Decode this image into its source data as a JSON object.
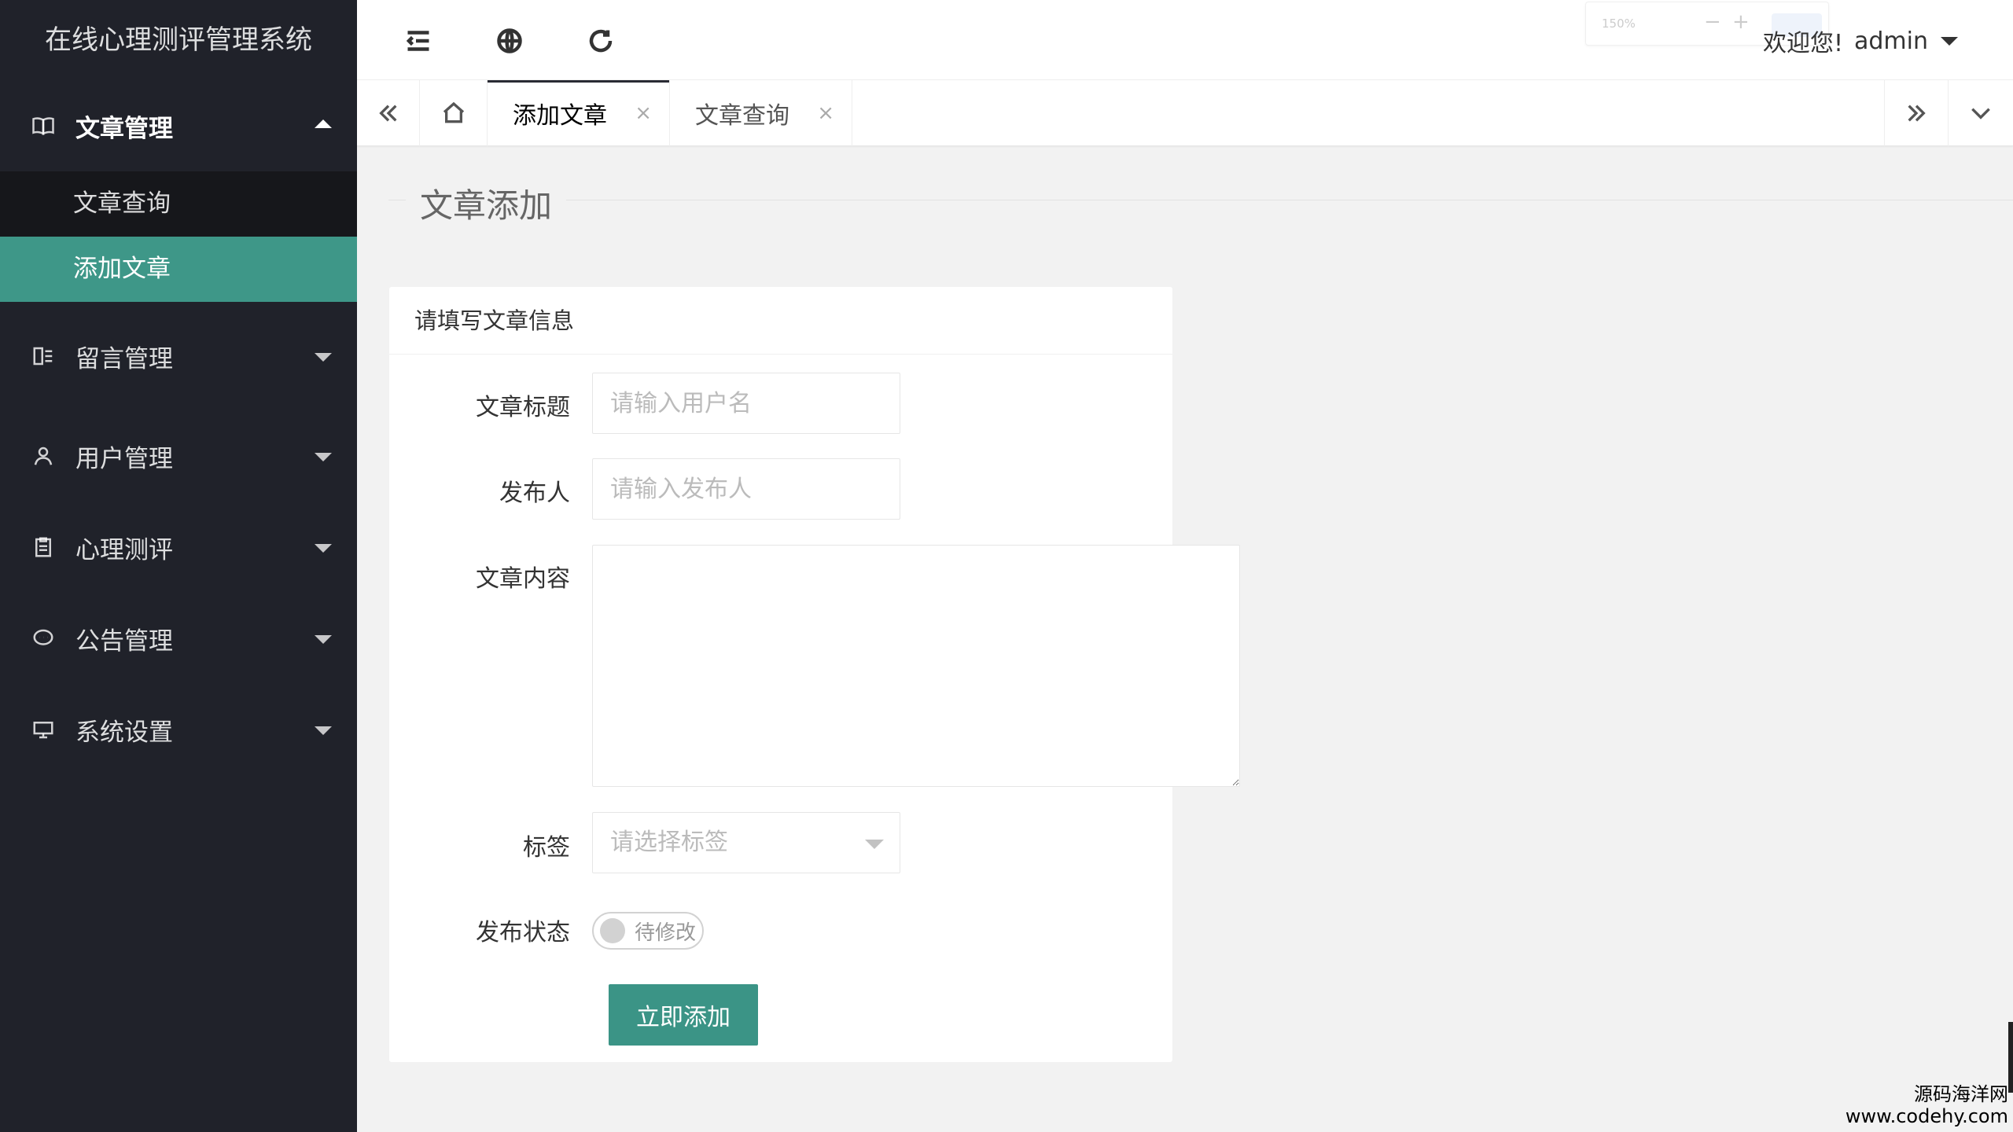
{
  "app": {
    "title": "在线心理测评管理系统"
  },
  "sidebar": {
    "groups": [
      {
        "label": "文章管理",
        "icon": "book-icon",
        "open": true,
        "items": [
          {
            "label": "文章查询"
          },
          {
            "label": "添加文章",
            "active": true
          }
        ]
      },
      {
        "label": "留言管理",
        "icon": "message-board-icon"
      },
      {
        "label": "用户管理",
        "icon": "user-icon"
      },
      {
        "label": "心理测评",
        "icon": "clipboard-icon"
      },
      {
        "label": "公告管理",
        "icon": "chat-bubble-icon"
      },
      {
        "label": "系统设置",
        "icon": "settings-monitor-icon"
      }
    ]
  },
  "header": {
    "zoom_value": "150%",
    "zoom_minus": "−",
    "zoom_plus": "+",
    "welcome": "欢迎您!",
    "username": "admin"
  },
  "tabs": [
    {
      "label": "添加文章",
      "active": true,
      "close": "×"
    },
    {
      "label": "文章查询",
      "active": false,
      "close": "×"
    }
  ],
  "page": {
    "title": "文章添加",
    "card_title": "请填写文章信息",
    "form": {
      "title_label": "文章标题",
      "title_placeholder": "请输入用户名",
      "author_label": "发布人",
      "author_placeholder": "请输入发布人",
      "content_label": "文章内容",
      "tag_label": "标签",
      "tag_placeholder": "请选择标签",
      "status_label": "发布状态",
      "status_text": "待修改",
      "submit": "立即添加"
    }
  },
  "watermark": {
    "line1": "源码海洋网",
    "line2": "www.codehy.com"
  }
}
